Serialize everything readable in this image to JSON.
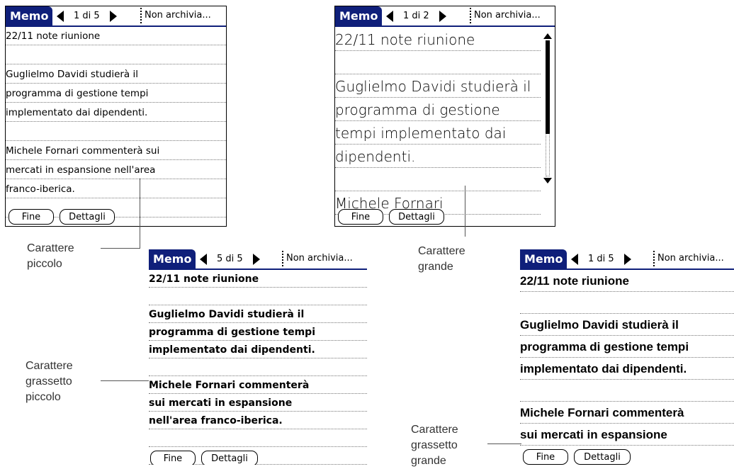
{
  "app_label": "Memo",
  "category_label": "Non archivia...",
  "buttons": {
    "done": "Fine",
    "details": "Dettagli"
  },
  "screens": {
    "small": {
      "page_indicator": "1 di 5",
      "lines": [
        "22/11 note riunione",
        "",
        "Guglielmo Davidi studierà il",
        "programma di gestione tempi",
        "implementato dai dipendenti.",
        "",
        "Michele Fornari commenterà sui",
        "mercati in espansione nell'area",
        "franco-iberica.",
        "",
        ""
      ]
    },
    "large": {
      "page_indicator": "1 di 2",
      "lines": [
        "22/11 note riunione",
        "",
        "Guglielmo Davidi studierà il",
        "programma di gestione",
        "tempi implementato dai",
        "dipendenti.",
        "",
        "Michele Fornari"
      ]
    },
    "bold_small": {
      "page_indicator": "5 di 5",
      "lines": [
        "22/11 note riunione",
        "",
        "Guglielmo Davidi studierà il",
        "programma di gestione tempi",
        "implementato dai dipendenti.",
        "",
        "Michele Fornari commenterà",
        "sui mercati in espansione",
        "nell'area franco-iberica.",
        "",
        "",
        ""
      ]
    },
    "bold_large": {
      "page_indicator": "1 di 5",
      "lines": [
        "22/11 note riunione",
        "",
        "Guglielmo Davidi studierà il",
        "programma di gestione tempi",
        "implementato dai dipendenti.",
        "",
        "Michele Fornari commenterà",
        "sui mercati in espansione",
        ""
      ]
    }
  },
  "captions": {
    "small": {
      "line1": "Carattere",
      "line2": "piccolo"
    },
    "large": {
      "line1": "Carattere",
      "line2": "grande"
    },
    "bold_small": {
      "line1": "Carattere",
      "line2": "grassetto",
      "line3": "piccolo"
    },
    "bold_large": {
      "line1": "Carattere",
      "line2": "grassetto",
      "line3": "grande"
    }
  },
  "colors": {
    "title_bar": "#0f1f7a"
  }
}
